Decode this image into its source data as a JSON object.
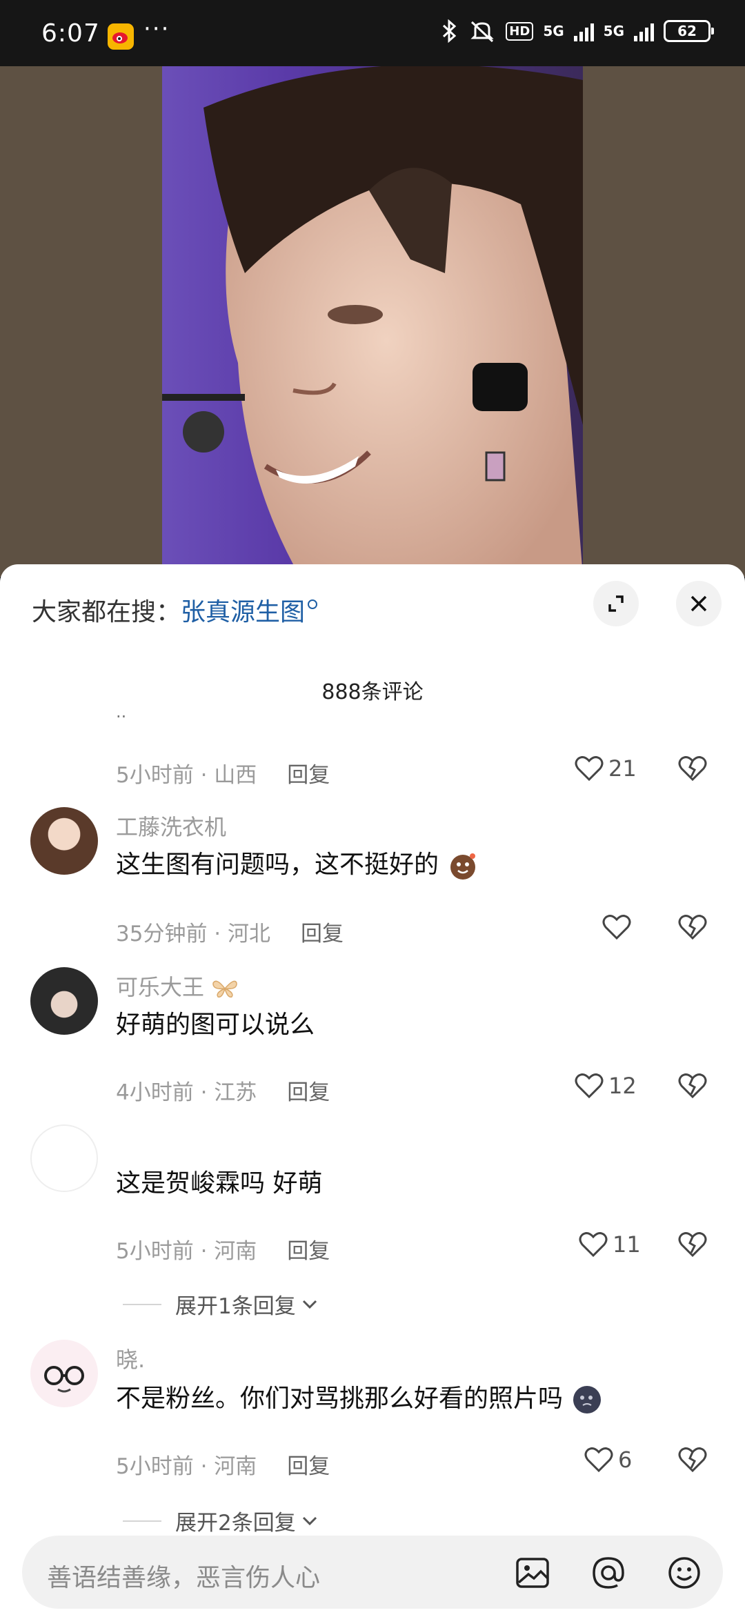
{
  "status_bar": {
    "time": "6:07",
    "dots": "···",
    "hd_label": "HD",
    "net1": "5G",
    "net2": "5G",
    "battery": "62"
  },
  "sheet": {
    "hot_search_prefix": "大家都在搜：",
    "hot_search_keyword": "张真源生图",
    "comment_count": "888条评论",
    "truncated_tail": "..",
    "reply_label": "回复"
  },
  "comments": [
    {
      "username": "",
      "text": "",
      "time": "5小时前",
      "location": "山西",
      "likes": "21"
    },
    {
      "username": "工藤洗衣机",
      "text": "这生图有问题吗，这不挺好的",
      "time": "35分钟前",
      "location": "河北",
      "likes": ""
    },
    {
      "username": "可乐大王",
      "text": "好萌的图可以说么",
      "time": "4小时前",
      "location": "江苏",
      "likes": "12"
    },
    {
      "username": "",
      "text": "这是贺峻霖吗 好萌",
      "time": "5小时前",
      "location": "河南",
      "likes": "11",
      "expand": "展开1条回复"
    },
    {
      "username": "晓.",
      "text": "不是粉丝。你们对骂挑那么好看的照片吗",
      "time": "5小时前",
      "location": "河南",
      "likes": "6",
      "expand": "展开2条回复"
    }
  ],
  "input": {
    "placeholder": "善语结善缘，恶言伤人心"
  },
  "colors": {
    "link_blue": "#1f5fa5",
    "meta_gray": "#9a9a9a",
    "sheet_bg": "#ffffff"
  }
}
